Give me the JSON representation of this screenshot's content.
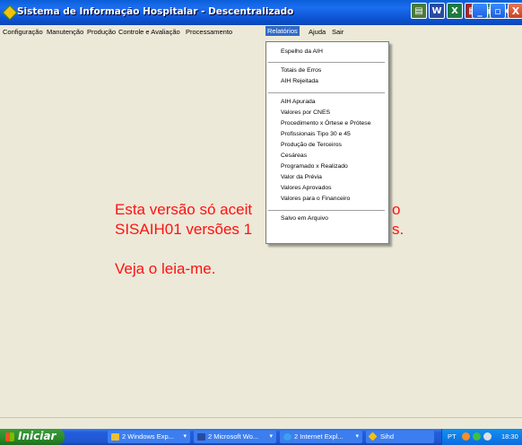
{
  "window": {
    "title": "Sistema de Informação Hospitalar - Descentralizado",
    "controls": {
      "minimize": "_",
      "maximize": "▫",
      "close": "X"
    }
  },
  "toolbar_icons": [
    {
      "name": "doc-icon",
      "color": "#4a7a3a"
    },
    {
      "name": "word-icon",
      "color": "#2a4aa0"
    },
    {
      "name": "excel-icon",
      "color": "#1e7a3e"
    },
    {
      "name": "access-icon",
      "color": "#a02a2a"
    },
    {
      "name": "calc-icon",
      "color": "#4a8a4a"
    },
    {
      "name": "ie-icon",
      "color": "#2a6ad0"
    }
  ],
  "menubar": {
    "items": [
      "Configuração",
      "Manutenção",
      "Produção",
      "Controle e Avaliação",
      "Processamento",
      "Relatórios",
      "Ajuda",
      "Sair"
    ],
    "active": "Relatórios"
  },
  "dropdown": {
    "groups": [
      [
        "Espelho da AIH"
      ],
      [
        "Totais de Erros",
        "AIH Rejeitada"
      ],
      [
        "AIH Apurada",
        "Valores por CNES",
        "Procedimento x Órtese e Prótese",
        "Profissionais Tipo 30 e 45",
        "Produção de Terceiros",
        "Cesáreas",
        "Programado x Realizado",
        "Valor da Prévia",
        "Valores Aprovados",
        "Valores para o Financeiro"
      ],
      [
        "Salvo em Arquivo"
      ]
    ]
  },
  "message": {
    "line1a": "Esta versão só aceit",
    "line1b": "o",
    "line2a": "SISAIH01 versões 1",
    "line2b": "s.",
    "line3": "Veja o leia-me.",
    "color": "#ff1111"
  },
  "taskbar": {
    "start_label": "Iniciar",
    "tasks": [
      {
        "label": "2 Windows Exp...",
        "icon": "folder-icon",
        "color": "#f0c030"
      },
      {
        "label": "2 Microsoft Wo...",
        "icon": "word-icon",
        "color": "#2a4aa0"
      },
      {
        "label": "2 Internet Expl...",
        "icon": "ie-icon",
        "color": "#3aa0f0"
      },
      {
        "label": "Sihd",
        "icon": "sihd-icon",
        "color": "#f4c20d"
      }
    ],
    "tray": {
      "lang": "PT",
      "time": "18:30"
    }
  }
}
